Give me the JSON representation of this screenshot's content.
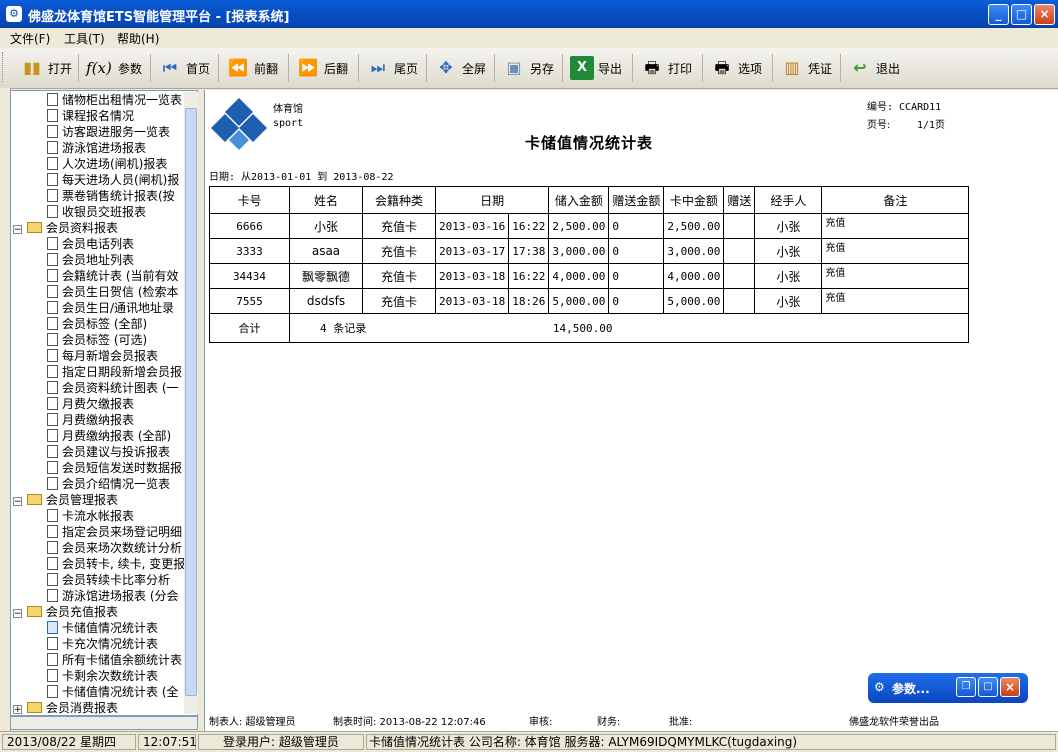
{
  "window": {
    "title": "佛盛龙体育馆ETS智能管理平台 - [报表系统]",
    "icon": "gear-icon",
    "controls": [
      "_",
      "□",
      "×"
    ]
  },
  "menu": [
    {
      "label": "文件(F)"
    },
    {
      "label": "工具(T)"
    },
    {
      "label": "帮助(H)"
    }
  ],
  "toolbar": [
    {
      "label": "打开",
      "icon": "book-icon"
    },
    {
      "label": "参数",
      "icon": "function-icon"
    },
    {
      "label": "首页",
      "icon": "first-page-icon"
    },
    {
      "label": "前翻",
      "icon": "prev-page-icon"
    },
    {
      "label": "后翻",
      "icon": "next-page-icon"
    },
    {
      "label": "尾页",
      "icon": "last-page-icon"
    },
    {
      "label": "全屏",
      "icon": "fullscreen-icon"
    },
    {
      "label": "另存",
      "icon": "save-as-icon"
    },
    {
      "label": "导出",
      "icon": "excel-icon"
    },
    {
      "label": "打印",
      "icon": "printer-icon"
    },
    {
      "label": "选项",
      "icon": "printer-options-icon"
    },
    {
      "label": "凭证",
      "icon": "voucher-icon"
    },
    {
      "label": "退出",
      "icon": "exit-icon"
    }
  ],
  "tree": [
    {
      "label": "储物柜出租情况一览表",
      "level": 2
    },
    {
      "label": "课程报名情况",
      "level": 2
    },
    {
      "label": "访客跟进服务一览表",
      "level": 2
    },
    {
      "label": "游泳馆进场报表",
      "level": 2
    },
    {
      "label": "人次进场(闸机)报表",
      "level": 2
    },
    {
      "label": "每天进场人员(闸机)报",
      "level": 2
    },
    {
      "label": "票卷销售统计报表(按",
      "level": 2
    },
    {
      "label": "收银员交班报表",
      "level": 2
    },
    {
      "label": "会员资料报表",
      "level": 1,
      "expander": "−"
    },
    {
      "label": "会员电话列表",
      "level": 2
    },
    {
      "label": "会员地址列表",
      "level": 2
    },
    {
      "label": "会籍统计表 (当前有效",
      "level": 2
    },
    {
      "label": "会员生日贺信 (检索本",
      "level": 2
    },
    {
      "label": "会员生日/通讯地址录",
      "level": 2
    },
    {
      "label": "会员标签 (全部)",
      "level": 2
    },
    {
      "label": "会员标签 (可选)",
      "level": 2
    },
    {
      "label": "每月新增会员报表",
      "level": 2
    },
    {
      "label": "指定日期段新增会员报",
      "level": 2
    },
    {
      "label": "会员资料统计图表 (一",
      "level": 2
    },
    {
      "label": "月费欠缴报表",
      "level": 2
    },
    {
      "label": "月费缴纳报表",
      "level": 2
    },
    {
      "label": "月费缴纳报表 (全部)",
      "level": 2
    },
    {
      "label": "会员建议与投诉报表",
      "level": 2
    },
    {
      "label": "会员短信发送时数据报",
      "level": 2
    },
    {
      "label": "会员介绍情况一览表",
      "level": 2
    },
    {
      "label": "会员管理报表",
      "level": 1,
      "expander": "−"
    },
    {
      "label": "卡流水帐报表",
      "level": 2
    },
    {
      "label": "指定会员来场登记明细",
      "level": 2
    },
    {
      "label": "会员来场次数统计分析",
      "level": 2
    },
    {
      "label": "会员转卡, 续卡, 变更报",
      "level": 2
    },
    {
      "label": "会员转续卡比率分析",
      "level": 2
    },
    {
      "label": "游泳馆进场报表 (分会",
      "level": 2
    },
    {
      "label": "会员充值报表",
      "level": 1,
      "expander": "−"
    },
    {
      "label": "卡储值情况统计表",
      "level": 2,
      "selected": true
    },
    {
      "label": "卡充次情况统计表",
      "level": 2
    },
    {
      "label": "所有卡储值余额统计表",
      "level": 2
    },
    {
      "label": "卡剩余次数统计表",
      "level": 2
    },
    {
      "label": "卡储值情况统计表 (全",
      "level": 2
    },
    {
      "label": "会员消费报表",
      "level": 1,
      "expander": "+"
    }
  ],
  "report": {
    "logo_line1": "体育馆",
    "logo_line2": "sport",
    "title": "卡储值情况统计表",
    "code_label": "编号: CCARD11",
    "page_label": "页号:",
    "page_value": "1/1页",
    "date_range": "日期: 从2013-01-01 到 2013-08-22",
    "columns": [
      "卡号",
      "姓名",
      "会籍种类",
      "日期",
      "储入金额",
      "赠送金额",
      "卡中金额",
      "赠送",
      "经手人",
      "备注"
    ],
    "rows": [
      {
        "card": "6666",
        "name": "小张",
        "type": "充值卡",
        "date": "2013-03-16",
        "time": "16:22",
        "deposit": "2,500.00",
        "bonus": "0",
        "balance": "2,500.00",
        "gift": "",
        "handler": "小张",
        "note": "充值"
      },
      {
        "card": "3333",
        "name": "asaa",
        "type": "充值卡",
        "date": "2013-03-17",
        "time": "17:38",
        "deposit": "3,000.00",
        "bonus": "0",
        "balance": "3,000.00",
        "gift": "",
        "handler": "小张",
        "note": "充值"
      },
      {
        "card": "34434",
        "name": "飘零飘德",
        "type": "充值卡",
        "date": "2013-03-18",
        "time": "16:22",
        "deposit": "4,000.00",
        "bonus": "0",
        "balance": "4,000.00",
        "gift": "",
        "handler": "小张",
        "note": "充值"
      },
      {
        "card": "7555",
        "name": "dsdsfs",
        "type": "充值卡",
        "date": "2013-03-18",
        "time": "18:26",
        "deposit": "5,000.00",
        "bonus": "0",
        "balance": "5,000.00",
        "gift": "",
        "handler": "小张",
        "note": "充值"
      }
    ],
    "total_label": "合计",
    "total_count": "4 条记录",
    "total_amount": "14,500.00",
    "footer": {
      "maker": "制表人: 超级管理员",
      "time": "制表时间: 2013-08-22 12:07:46",
      "audit": "审核:",
      "finance": "财务:",
      "approve": "批准:",
      "vendor": "佛盛龙软件荣誉出品"
    }
  },
  "popup": {
    "label": "参数...",
    "icon": "gear-icon"
  },
  "status": {
    "date": "2013/08/22 星期四",
    "time": "12:07:51",
    "user": "登录用户: 超级管理员",
    "info": "卡储值情况统计表 公司名称: 体育馆 服务器: ALYM69IDQMYMLKC(tugdaxing)"
  }
}
